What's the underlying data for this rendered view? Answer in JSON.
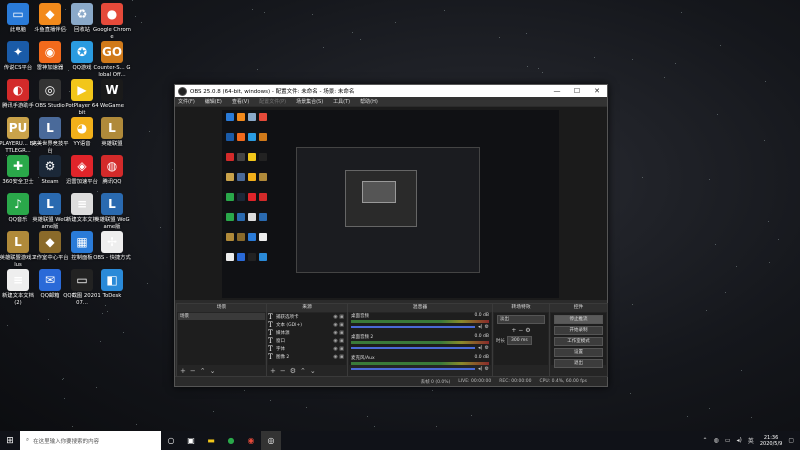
{
  "desktop": {
    "icons": [
      {
        "label": "此电脑",
        "glyph": "▭",
        "color": "#2a7bd8"
      },
      {
        "label": "斗鱼直播伴侣",
        "glyph": "◆",
        "color": "#f28a1c"
      },
      {
        "label": "回收站",
        "glyph": "♻",
        "color": "#8aa9c9"
      },
      {
        "label": "Google Chrome",
        "glyph": "●",
        "color": "#e54a3a"
      },
      {
        "label": "传说CS平台",
        "glyph": "✦",
        "color": "#1a5ba8"
      },
      {
        "label": "雷神加速器",
        "glyph": "◉",
        "color": "#f26a1c"
      },
      {
        "label": "QQ游戏",
        "glyph": "✪",
        "color": "#2a9be0"
      },
      {
        "label": "Counter-S... Global Off...",
        "glyph": "GO",
        "color": "#d07a1a"
      },
      {
        "label": "腾讯手游助手",
        "glyph": "◐",
        "color": "#d32a2a"
      },
      {
        "label": "OBS Studio",
        "glyph": "◎",
        "color": "#333"
      },
      {
        "label": "PotPlayer 64 bit",
        "glyph": "▶",
        "color": "#f2c61a"
      },
      {
        "label": "WeGame",
        "glyph": "W",
        "color": "#1a1a1a"
      },
      {
        "label": "PLAYERU... BATTLEGR...",
        "glyph": "PU",
        "color": "#c9a24a"
      },
      {
        "label": "完美世界竞技平台",
        "glyph": "L",
        "color": "#4a6a9a"
      },
      {
        "label": "YY语音",
        "glyph": "◕",
        "color": "#f2b01a"
      },
      {
        "label": "英雄联盟",
        "glyph": "L",
        "color": "#b08a3a"
      },
      {
        "label": "360安全卫士",
        "glyph": "✚",
        "color": "#2aa84a"
      },
      {
        "label": "Steam",
        "glyph": "⚙",
        "color": "#1b2838"
      },
      {
        "label": "迅雷加速平台",
        "glyph": "◈",
        "color": "#e0242a"
      },
      {
        "label": "腾讯QQ",
        "glyph": "◍",
        "color": "#d32a2a"
      },
      {
        "label": "QQ音乐",
        "glyph": "♪",
        "color": "#2aa84a"
      },
      {
        "label": "英雄联盟 WeGame版",
        "glyph": "L",
        "color": "#2a6ab0"
      },
      {
        "label": "新建文本文档",
        "glyph": "≡",
        "color": "#ddd"
      },
      {
        "label": "英雄联盟 WeGame版",
        "glyph": "L",
        "color": "#2a6ab0"
      },
      {
        "label": "英雄联盟游戏 Plus",
        "glyph": "L",
        "color": "#b08a3a"
      },
      {
        "label": "工作室中心平台",
        "glyph": "◆",
        "color": "#8a6a2a"
      },
      {
        "label": "控制面板",
        "glyph": "▦",
        "color": "#2a7bd8"
      },
      {
        "label": "OBS - 快捷方式",
        "glyph": "✢",
        "color": "#eee"
      },
      {
        "label": "新建文本文档 (2)",
        "glyph": "≡",
        "color": "#eee"
      },
      {
        "label": "QQ邮箱",
        "glyph": "✉",
        "color": "#2a6ad8"
      },
      {
        "label": "QQ截图 2020107...",
        "glyph": "▭",
        "color": "#222"
      },
      {
        "label": "ToDesk",
        "glyph": "◧",
        "color": "#2a8ad8"
      }
    ]
  },
  "obs": {
    "title": "OBS 25.0.8 (64-bit, windows) - 配置文件: 未命名 - 场景: 未命名",
    "window_buttons": [
      "—",
      "☐",
      "✕"
    ],
    "menu": [
      "文件(F)",
      "编辑(E)",
      "查看(V)",
      "配置文件(P)",
      "场景集合(S)",
      "工具(T)",
      "帮助(H)"
    ],
    "docks": {
      "scenes": {
        "title": "场景",
        "items": [
          "场景"
        ]
      },
      "sources": {
        "title": "来源",
        "items": [
          "捕获选项卡",
          "文本 (GDI+)",
          "媒体源",
          "窗口",
          "字体",
          "图像 2"
        ]
      },
      "mixer": {
        "title": "混音器",
        "channels": [
          {
            "name": "桌面音频",
            "db": "0.0 dB"
          },
          {
            "name": "桌面音频 2",
            "db": "0.0 dB"
          },
          {
            "name": "麦克风/Aux",
            "db": "0.0 dB"
          }
        ]
      },
      "transitions": {
        "title": "转场特效",
        "type": "淡出",
        "duration_label": "时长",
        "duration": "300 ms"
      },
      "controls": {
        "title": "控件",
        "buttons": [
          "停止推流",
          "开始录制",
          "工作室模式",
          "设置",
          "退出"
        ]
      }
    },
    "status": {
      "live": "LIVE: 00:00:00",
      "rec": "REC: 00:00:00",
      "cpu": "CPU: 0.4%, 60.00 fps",
      "drop": "丢帧 0 (0.0%)"
    }
  },
  "taskbar": {
    "search_placeholder": "在这里输入你要搜索的内容",
    "time": "21:36",
    "date": "2020/5/9",
    "lang": "英"
  }
}
